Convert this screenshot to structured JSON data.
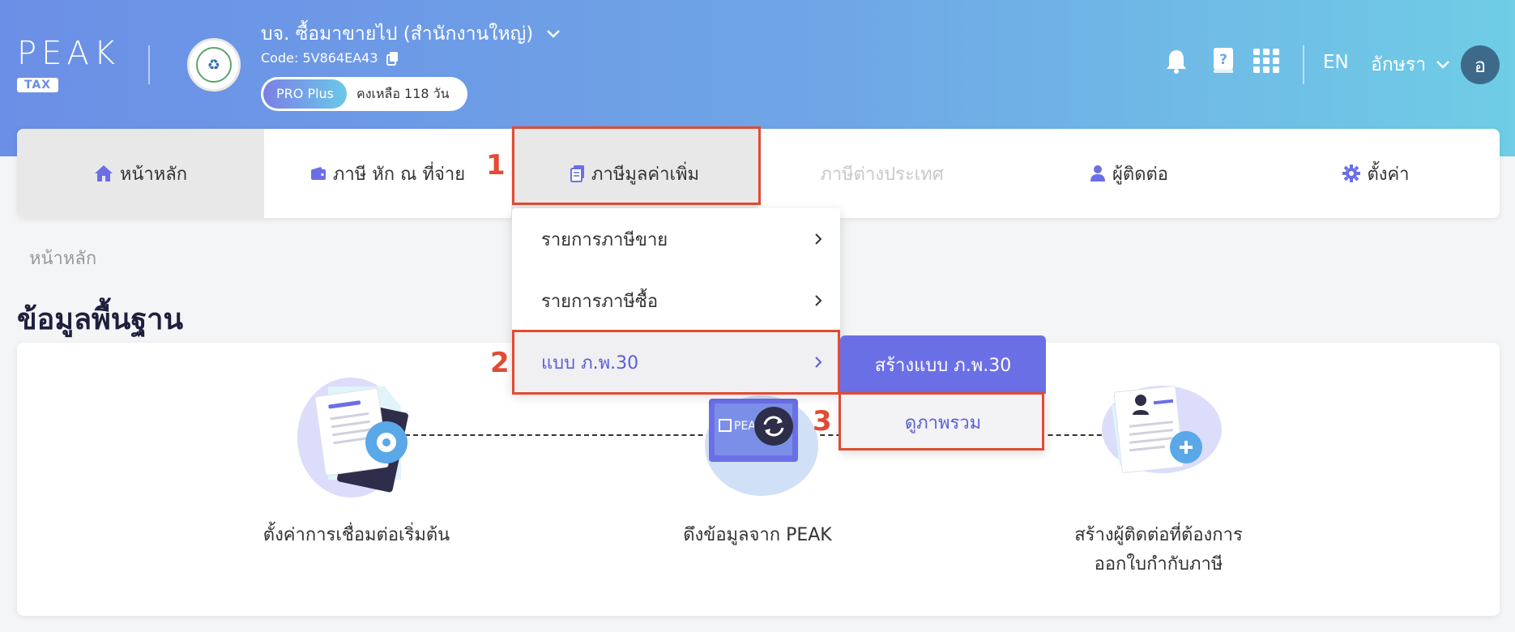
{
  "header": {
    "logo": "PEAK",
    "logo_tag": "TAX",
    "company_name": "บจ. ซื้อมาขายไป (สำนักงานใหญ่)",
    "company_code": "Code: 5V864EA43",
    "plan": "PRO Plus",
    "plan_remaining": "คงเหลือ 118 วัน",
    "language": "EN",
    "user_name": "อักษรา",
    "avatar_initial": "อ"
  },
  "nav": {
    "items": [
      {
        "label": "หน้าหลัก",
        "icon": "home-icon"
      },
      {
        "label": "ภาษี หัก ณ ที่จ่าย",
        "icon": "wallet-icon"
      },
      {
        "label": "ภาษีมูลค่าเพิ่ม",
        "icon": "document-icon"
      },
      {
        "label": "ภาษีต่างประเทศ",
        "icon": ""
      },
      {
        "label": "ผู้ติดต่อ",
        "icon": "user-icon"
      },
      {
        "label": "ตั้งค่า",
        "icon": "gear-icon"
      }
    ]
  },
  "dropdown": {
    "items": [
      {
        "label": "รายการภาษีขาย"
      },
      {
        "label": "รายการภาษีซื้อ"
      },
      {
        "label": "แบบ ภ.พ.30"
      }
    ]
  },
  "submenu": {
    "create": "สร้างแบบ ภ.พ.30",
    "view": "ดูภาพรวม"
  },
  "steps": {
    "one": "1",
    "two": "2",
    "three": "3"
  },
  "breadcrumb": "หน้าหลัก",
  "page_title": "ข้อมูลพื้นฐาน",
  "onboarding": {
    "step1": "ตั้งค่าการเชื่อมต่อเริ่มต้น",
    "step2": "ดึงข้อมูลจาก PEAK",
    "step3_line1": "สร้างผู้ติดต่อที่ต้องการ",
    "step3_line2": "ออกใบกำกับภาษี",
    "peak_screen_text": "PEAK"
  },
  "colors": {
    "accent": "#6b6fe6",
    "highlight": "#e24a33"
  }
}
